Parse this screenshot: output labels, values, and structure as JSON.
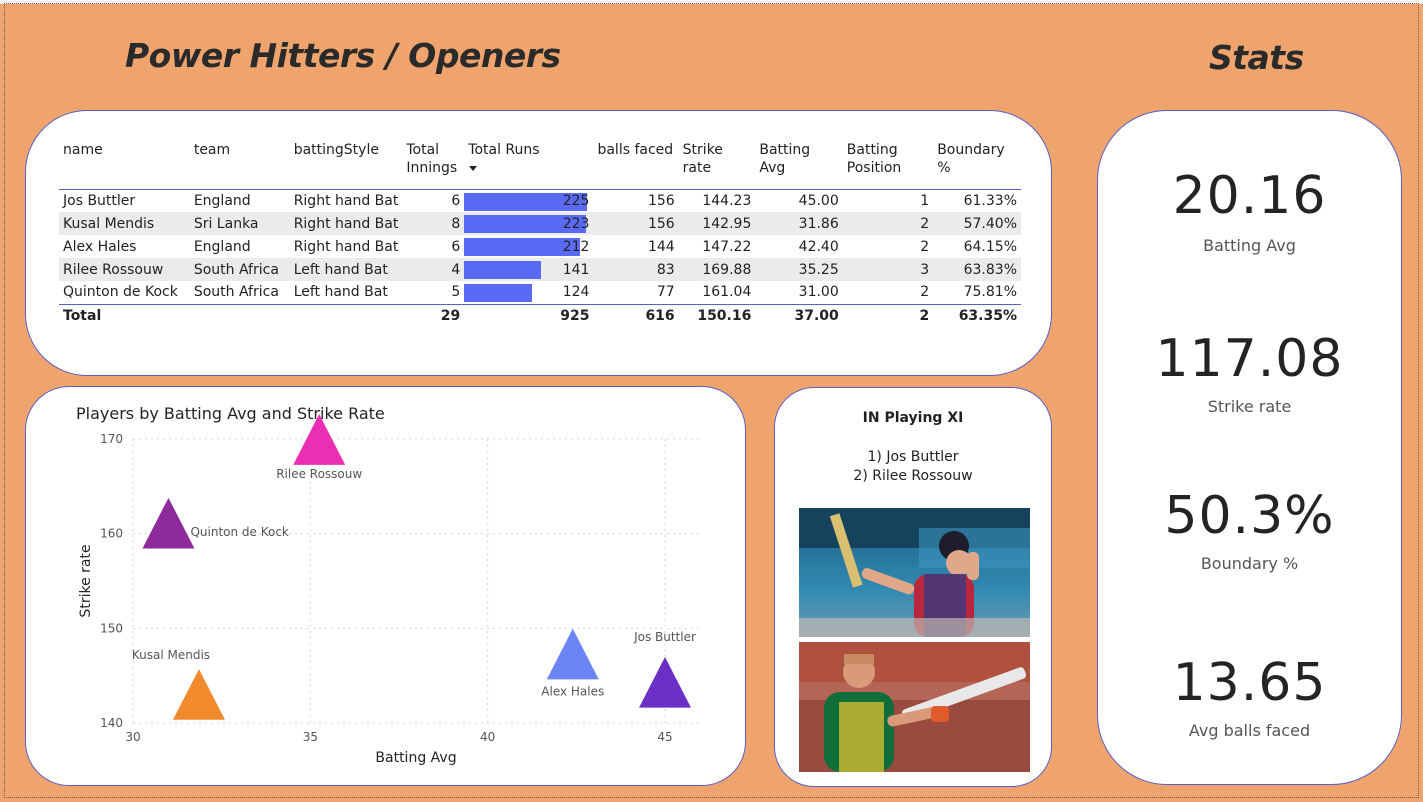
{
  "headings": {
    "left": "Power Hitters / Openers",
    "right": "Stats"
  },
  "table": {
    "columns": [
      "name",
      "team",
      "battingStyle",
      "Total Innings",
      "Total Runs",
      "balls faced",
      "Strike rate",
      "Batting Avg",
      "Batting Position",
      "Boundary %"
    ],
    "column_lines": {
      "innings": [
        "Total",
        "Innings"
      ],
      "position": [
        "Batting",
        "Position"
      ]
    },
    "sort_indicator": "sort-descending-icon",
    "rows": [
      [
        "Jos Buttler",
        "England",
        "Right hand Bat",
        "6",
        "225",
        "156",
        "144.23",
        "45.00",
        "1",
        "61.33%"
      ],
      [
        "Kusal Mendis",
        "Sri Lanka",
        "Right hand Bat",
        "8",
        "223",
        "156",
        "142.95",
        "31.86",
        "2",
        "57.40%"
      ],
      [
        "Alex Hales",
        "England",
        "Right hand Bat",
        "6",
        "212",
        "144",
        "147.22",
        "42.40",
        "2",
        "64.15%"
      ],
      [
        "Rilee Rossouw",
        "South Africa",
        "Left hand Bat",
        "4",
        "141",
        "83",
        "169.88",
        "35.25",
        "3",
        "63.83%"
      ],
      [
        "Quinton de Kock",
        "South Africa",
        "Left hand Bat",
        "5",
        "124",
        "77",
        "161.04",
        "31.00",
        "2",
        "75.81%"
      ]
    ],
    "bar_values": [
      225,
      223,
      212,
      141,
      124
    ],
    "bar_max": 225,
    "bar_color": "#5b6af5",
    "total": [
      "Total",
      "",
      "",
      "29",
      "925",
      "616",
      "150.16",
      "37.00",
      "2",
      "63.35%"
    ]
  },
  "chart_data": {
    "type": "scatter",
    "title": "Players by Batting Avg and Strike Rate",
    "xlabel": "Batting Avg",
    "ylabel": "Strike rate",
    "xlim": [
      30,
      46
    ],
    "ylim": [
      140,
      170
    ],
    "xticks": [
      "30",
      "35",
      "40",
      "45"
    ],
    "yticks": [
      "140",
      "150",
      "160",
      "170"
    ],
    "grid": true,
    "marker": "triangle",
    "points": [
      {
        "label": "Jos Buttler",
        "x": 45.0,
        "y": 144.23,
        "color": "#6a2fc4"
      },
      {
        "label": "Kusal Mendis",
        "x": 31.86,
        "y": 142.95,
        "color": "#f08a2c"
      },
      {
        "label": "Alex Hales",
        "x": 42.4,
        "y": 147.22,
        "color": "#6b85f7"
      },
      {
        "label": "Rilee Rossouw",
        "x": 35.25,
        "y": 169.88,
        "color": "#ea2fb3"
      },
      {
        "label": "Quinton de Kock",
        "x": 31.0,
        "y": 161.04,
        "color": "#8e2a9b"
      }
    ]
  },
  "playing_xi": {
    "title": "IN Playing XI",
    "players": [
      "1) Jos Buttler",
      "2) Rilee Rossouw"
    ]
  },
  "stats": [
    {
      "value": "20.16",
      "label": "Batting Avg"
    },
    {
      "value": "117.08",
      "label": "Strike rate"
    },
    {
      "value": "50.3%",
      "label": "Boundary %"
    },
    {
      "value": "13.65",
      "label": "Avg balls faced"
    }
  ],
  "colors": {
    "background": "#eea46c",
    "border": "#5a5fc8",
    "card": "#ffffff"
  }
}
